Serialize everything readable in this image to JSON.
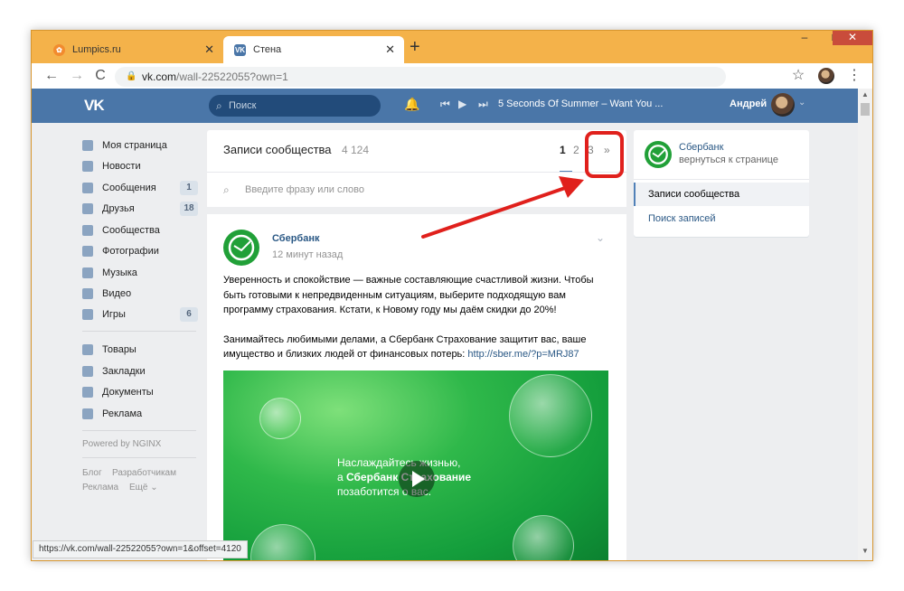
{
  "browser": {
    "tabs": [
      {
        "title": "Lumpics.ru",
        "favicon": "lumpics-favicon",
        "color": "#f28b2e"
      },
      {
        "title": "Стена",
        "favicon": "vk-favicon",
        "color": "#4a76a8"
      }
    ],
    "new_tab": "+",
    "window_controls": {
      "minimize": "–",
      "maximize": "□",
      "close": "✕"
    },
    "nav": {
      "back": "←",
      "forward": "→",
      "reload": "C"
    },
    "url": {
      "host": "vk.com",
      "path": "/wall-22522055?own=1"
    },
    "star": "☆",
    "menu": "⋮",
    "status_url": "https://vk.com/wall-22522055?own=1&offset=4120"
  },
  "vk": {
    "logo": "VK",
    "search_placeholder": "Поиск",
    "player": {
      "prev": "⏮",
      "play": "▶",
      "next": "⏭",
      "track": "5 Seconds Of Summer – Want You ..."
    },
    "user_name": "Андрей",
    "brand_color": "#4a76a8"
  },
  "sidebar": {
    "items": [
      {
        "label": "Моя страница",
        "count": ""
      },
      {
        "label": "Новости",
        "count": ""
      },
      {
        "label": "Сообщения",
        "count": "1"
      },
      {
        "label": "Друзья",
        "count": "18"
      },
      {
        "label": "Сообщества",
        "count": ""
      },
      {
        "label": "Фотографии",
        "count": ""
      },
      {
        "label": "Музыка",
        "count": ""
      },
      {
        "label": "Видео",
        "count": ""
      },
      {
        "label": "Игры",
        "count": "6"
      }
    ],
    "items2": [
      {
        "label": "Товары"
      },
      {
        "label": "Закладки"
      },
      {
        "label": "Документы"
      },
      {
        "label": "Реклама"
      }
    ],
    "powered": "Powered by NGINX",
    "footer": {
      "blog": "Блог",
      "dev": "Разработчикам",
      "ads": "Реклама",
      "more": "Ещё ⌄"
    }
  },
  "wall": {
    "title": "Записи сообщества",
    "count": "4 124",
    "pages": [
      "1",
      "2",
      "3",
      "»"
    ],
    "search_placeholder": "Введите фразу или слово",
    "post": {
      "author": "Сбербанк",
      "time": "12 минут назад",
      "paragraph1": "Уверенность и спокойствие — важные составляющие счастливой жизни. Чтобы быть готовыми к непредвиденным ситуациям, выберите подходящую вам программу страхования. Кстати, к Новому году мы даём скидки до 20%!",
      "paragraph2": "Занимайтесь любимыми делами, а Сбербанк Страхование защитит вас, ваше имущество и близких людей от финансовых потерь:",
      "link": "http://sber.me/?p=MRJ87",
      "video_line1": "Наслаждайтесь жизнью,",
      "video_line2_prefix": "а ",
      "video_line2_bold": "Сбербанк Страхование",
      "video_line3": "позаботится о вас."
    }
  },
  "right": {
    "name": "Сбербанк",
    "back": "вернуться к странице",
    "menu": [
      "Записи сообщества",
      "Поиск записей"
    ]
  },
  "annotation": {
    "highlight_color": "#e0201c"
  }
}
